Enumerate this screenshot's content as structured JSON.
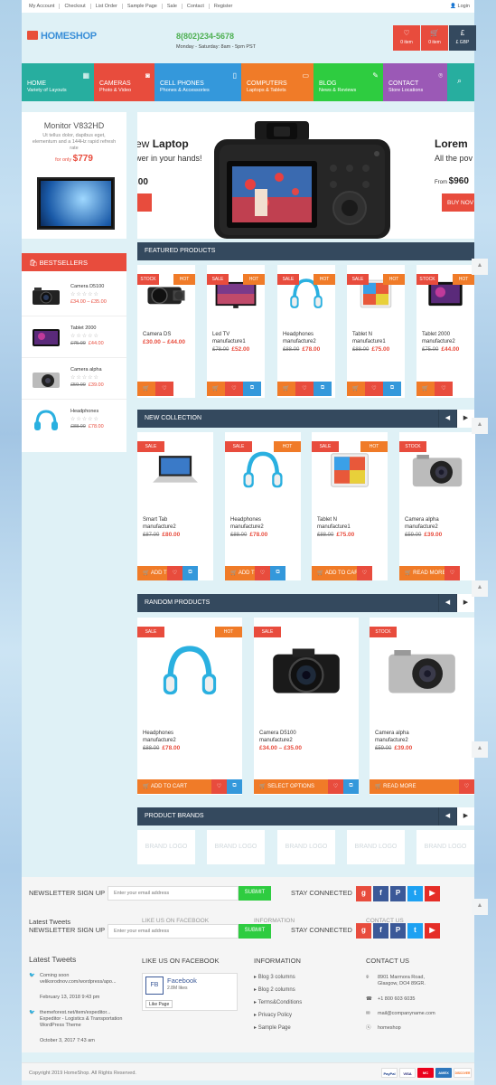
{
  "topbar": {
    "links": [
      "My Account",
      "Checkout",
      "List Order",
      "Sample Page",
      "Sale",
      "Contact",
      "Register"
    ],
    "login": "Login"
  },
  "header": {
    "logo": "HOMESHOP",
    "phone": "8(802)234-5678",
    "hours": "Monday - Saturday: 8am - 5pm PST",
    "wishlist": "0 item",
    "cart": "0 item",
    "currency_symbol": "£",
    "currency": "£ GBP"
  },
  "nav": [
    {
      "title": "HOME",
      "sub": "Variety of Layouts",
      "color": "#27ae9f"
    },
    {
      "title": "CAMERAS",
      "sub": "Photo & Video",
      "color": "#e84c3d"
    },
    {
      "title": "CELL PHONES",
      "sub": "Phones & Accessories",
      "color": "#3498db"
    },
    {
      "title": "COMPUTERS",
      "sub": "Laptops & Tablets",
      "color": "#f07b28"
    },
    {
      "title": "BLOG",
      "sub": "News & Reviews",
      "color": "#2ecc40"
    },
    {
      "title": "CONTACT",
      "sub": "Store Locations",
      "color": "#9b59b6"
    }
  ],
  "side_banner": {
    "title": "Monitor V832HD",
    "desc": "Ut tellus dolor, dapibus eget, elementum and a 144Hz rapid refresh rate",
    "price_prefix": "for only",
    "price": "$779"
  },
  "bestsellers": {
    "title": "BESTSELLERS",
    "stars": "☆☆☆☆☆",
    "items": [
      {
        "name": "Camera D5100",
        "old": "",
        "price": "£34.00 – £35.00"
      },
      {
        "name": "Tablet 2000",
        "old": "£75.00",
        "price": "£44.00"
      },
      {
        "name": "Camera alpha",
        "old": "£59.00",
        "price": "£39.00"
      },
      {
        "name": "Headphones",
        "old": "£88.00",
        "price": "£78.00"
      }
    ]
  },
  "hero": {
    "left_title_light": "ew ",
    "left_title_bold": "Laptop",
    "left_sub": "wer in your hands!",
    "left_price": ".00",
    "right_title": "Lorem",
    "right_sub": "All the pov",
    "right_price_prefix": "From",
    "right_price": "$960",
    "right_btn": "BUY NOV"
  },
  "featured": {
    "title": "FEATURED PRODUCTS",
    "items": [
      {
        "name1": "Camera DS",
        "name2": "",
        "old": "",
        "price": "£30.00 – £44.00",
        "b1": "STOCK",
        "b2": "HOT"
      },
      {
        "name1": "Led TV",
        "name2": "manufacture1",
        "old": "£78.00",
        "price": "£52.00",
        "b1": "SALE",
        "b2": "HOT"
      },
      {
        "name1": "Headphones",
        "name2": "manufacture2",
        "old": "£88.00",
        "price": "£78.00",
        "b1": "SALE",
        "b2": "HOT"
      },
      {
        "name1": "Tablet N",
        "name2": "manufacture1",
        "old": "£88.00",
        "price": "£75.00",
        "b1": "SALE",
        "b2": "HOT"
      },
      {
        "name1": "Tablet 2000",
        "name2": "manufacture2",
        "old": "£75.00",
        "price": "£44.00",
        "b1": "STOCK",
        "b2": "HOT"
      }
    ]
  },
  "new_collection": {
    "title": "NEW COLLECTION",
    "items": [
      {
        "name1": "Smart Tab",
        "name2": "manufacture2",
        "old": "£87.00",
        "price": "£80.00",
        "b1": "SALE",
        "b2": "",
        "btn": "ADD TO CA"
      },
      {
        "name1": "Headphones",
        "name2": "manufacture2",
        "old": "£88.00",
        "price": "£78.00",
        "b1": "SALE",
        "b2": "HOT",
        "btn": "ADD TO CA"
      },
      {
        "name1": "Tablet N",
        "name2": "manufacture1",
        "old": "£88.00",
        "price": "£75.00",
        "b1": "SALE",
        "b2": "HOT",
        "btn": "ADD TO CART"
      },
      {
        "name1": "Camera alpha",
        "name2": "manufacture2",
        "old": "£59.00",
        "price": "£39.00",
        "b1": "STOCK",
        "b2": "",
        "btn": "READ MORE"
      }
    ]
  },
  "random": {
    "title": "RANDOM PRODUCTS",
    "items": [
      {
        "name1": "Headphones",
        "name2": "manufacture2",
        "old": "£88.00",
        "price": "£78.00",
        "b1": "SALE",
        "b2": "HOT",
        "btn": "ADD TO CART"
      },
      {
        "name1": "Camera D5100",
        "name2": "manufacture2",
        "old": "",
        "price": "£34.00 – £35.00",
        "b1": "SALE",
        "b2": "",
        "btn": "SELECT OPTIONS"
      },
      {
        "name1": "Camera alpha",
        "name2": "manufacture2",
        "old": "£59.00",
        "price": "£39.00",
        "b1": "STOCK",
        "b2": "",
        "btn": "READ MORE"
      }
    ]
  },
  "brands": {
    "title": "PRODUCT BRANDS",
    "logos": [
      "BRAND LOGO",
      "BRAND LOGO",
      "BRAND LOGO",
      "BRAND LOGO",
      "BRAND LOGO"
    ]
  },
  "newsletter": {
    "title": "NEWSLETTER SIGN UP",
    "placeholder": "Enter your email address",
    "submit": "SUBMIT",
    "stay": "STAY CONNECTED"
  },
  "ghost": {
    "tweets": "Latest Tweets",
    "facebook": "LIKE US ON FACEBOOK",
    "information": "INFORMATION",
    "contact": "CONTACT US"
  },
  "footer": {
    "tweets_title": "Latest Tweets",
    "tweet1a": "Coming soon",
    "tweet1b": "velikorodnov.com/wordpress/apo...",
    "tweet1date": "February 13, 2018 9:43 pm",
    "tweet2a": "themeforest.net/item/expeditor...",
    "tweet2b": "Expeditor - Logistics & Transportation",
    "tweet2c": "WordPress Theme",
    "tweet2date": "October 3, 2017 7:43 am",
    "fb_title": "LIKE US ON FACEBOOK",
    "fb_name": "Facebook",
    "fb_likes": "2.8M likes",
    "fb_like_btn": "Like Page",
    "info_title": "INFORMATION",
    "info_links": [
      "Blog 3 columns",
      "Blog 2 columns",
      "Terms&Conditions",
      "Privacy Policy",
      "Sample Page"
    ],
    "contact_title": "CONTACT US",
    "addr1": "8901 Marmora Road,",
    "addr2": "Glasgow, DO4 89GR.",
    "phone": "+1 800 603 6035",
    "email": "mail@companyname.com",
    "skype": "homeshop"
  },
  "copyright": "Copyright 2019 HomeShop. All Rights Reserved.",
  "payments": [
    "PayPal",
    "VISA",
    "MC",
    "AMEX",
    "DISCOVER"
  ]
}
